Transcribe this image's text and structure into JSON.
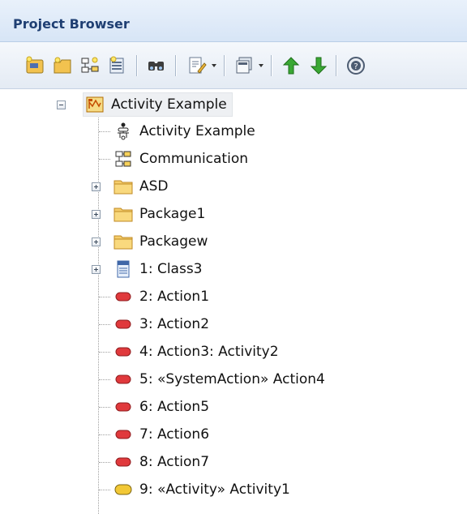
{
  "window": {
    "title": "Project Browser"
  },
  "toolbar": {
    "buttons": [
      "new-model-icon",
      "new-view-icon",
      "new-diagram-icon",
      "new-element-icon",
      "find-icon",
      "edit-icon",
      "dropdown-arrow-icon",
      "layout-icon",
      "dropdown-arrow-icon",
      "move-up-icon",
      "move-down-icon",
      "help-icon"
    ]
  },
  "tree": {
    "root": {
      "label": "Activity Example",
      "icon": "package-diagram-icon",
      "expanded": true
    },
    "items": [
      {
        "label": "Activity Example",
        "icon": "activity-diagram-icon",
        "expandable": false
      },
      {
        "label": "Communication",
        "icon": "communication-diagram-icon",
        "expandable": false
      },
      {
        "label": "ASD",
        "icon": "folder-icon",
        "expandable": true
      },
      {
        "label": "Package1",
        "icon": "folder-icon",
        "expandable": true
      },
      {
        "label": "Packagew",
        "icon": "folder-icon",
        "expandable": true
      },
      {
        "label": "1: Class3",
        "icon": "class-icon",
        "expandable": true
      },
      {
        "label": "2: Action1",
        "icon": "action-icon",
        "expandable": false
      },
      {
        "label": "3: Action2",
        "icon": "action-icon",
        "expandable": false
      },
      {
        "label": "4: Action3: Activity2",
        "icon": "action-icon",
        "expandable": false
      },
      {
        "label": "5: «SystemAction» Action4",
        "icon": "action-icon",
        "expandable": false
      },
      {
        "label": "6: Action5",
        "icon": "action-icon",
        "expandable": false
      },
      {
        "label": "7: Action6",
        "icon": "action-icon",
        "expandable": false
      },
      {
        "label": "8: Action7",
        "icon": "action-icon",
        "expandable": false
      },
      {
        "label": "9: «Activity» Activity1",
        "icon": "activity-icon",
        "expandable": false
      }
    ]
  },
  "colors": {
    "title_text": "#1f3f73",
    "folder": "#f3c55a",
    "action": "#e0393c",
    "activity": "#f2c836",
    "arrow_green": "#2e9b2a"
  }
}
